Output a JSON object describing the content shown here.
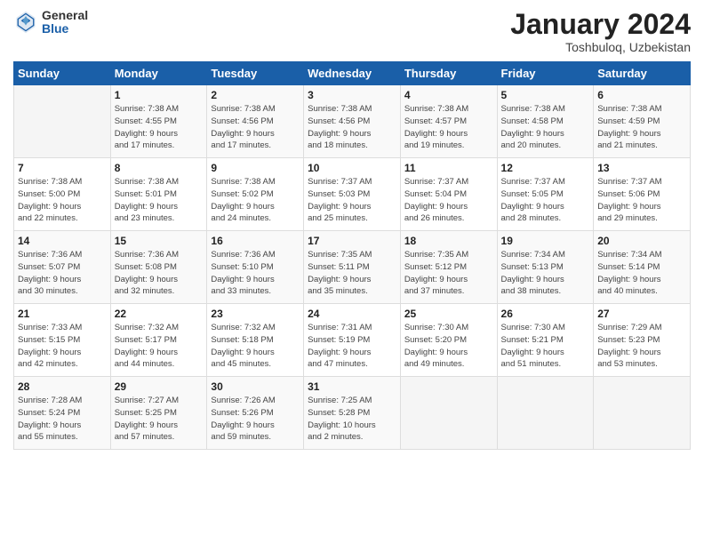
{
  "header": {
    "logo_general": "General",
    "logo_blue": "Blue",
    "month_title": "January 2024",
    "location": "Toshbuloq, Uzbekistan"
  },
  "days_of_week": [
    "Sunday",
    "Monday",
    "Tuesday",
    "Wednesday",
    "Thursday",
    "Friday",
    "Saturday"
  ],
  "weeks": [
    [
      {
        "day": "",
        "info": ""
      },
      {
        "day": "1",
        "info": "Sunrise: 7:38 AM\nSunset: 4:55 PM\nDaylight: 9 hours\nand 17 minutes."
      },
      {
        "day": "2",
        "info": "Sunrise: 7:38 AM\nSunset: 4:56 PM\nDaylight: 9 hours\nand 17 minutes."
      },
      {
        "day": "3",
        "info": "Sunrise: 7:38 AM\nSunset: 4:56 PM\nDaylight: 9 hours\nand 18 minutes."
      },
      {
        "day": "4",
        "info": "Sunrise: 7:38 AM\nSunset: 4:57 PM\nDaylight: 9 hours\nand 19 minutes."
      },
      {
        "day": "5",
        "info": "Sunrise: 7:38 AM\nSunset: 4:58 PM\nDaylight: 9 hours\nand 20 minutes."
      },
      {
        "day": "6",
        "info": "Sunrise: 7:38 AM\nSunset: 4:59 PM\nDaylight: 9 hours\nand 21 minutes."
      }
    ],
    [
      {
        "day": "7",
        "info": "Sunrise: 7:38 AM\nSunset: 5:00 PM\nDaylight: 9 hours\nand 22 minutes."
      },
      {
        "day": "8",
        "info": "Sunrise: 7:38 AM\nSunset: 5:01 PM\nDaylight: 9 hours\nand 23 minutes."
      },
      {
        "day": "9",
        "info": "Sunrise: 7:38 AM\nSunset: 5:02 PM\nDaylight: 9 hours\nand 24 minutes."
      },
      {
        "day": "10",
        "info": "Sunrise: 7:37 AM\nSunset: 5:03 PM\nDaylight: 9 hours\nand 25 minutes."
      },
      {
        "day": "11",
        "info": "Sunrise: 7:37 AM\nSunset: 5:04 PM\nDaylight: 9 hours\nand 26 minutes."
      },
      {
        "day": "12",
        "info": "Sunrise: 7:37 AM\nSunset: 5:05 PM\nDaylight: 9 hours\nand 28 minutes."
      },
      {
        "day": "13",
        "info": "Sunrise: 7:37 AM\nSunset: 5:06 PM\nDaylight: 9 hours\nand 29 minutes."
      }
    ],
    [
      {
        "day": "14",
        "info": "Sunrise: 7:36 AM\nSunset: 5:07 PM\nDaylight: 9 hours\nand 30 minutes."
      },
      {
        "day": "15",
        "info": "Sunrise: 7:36 AM\nSunset: 5:08 PM\nDaylight: 9 hours\nand 32 minutes."
      },
      {
        "day": "16",
        "info": "Sunrise: 7:36 AM\nSunset: 5:10 PM\nDaylight: 9 hours\nand 33 minutes."
      },
      {
        "day": "17",
        "info": "Sunrise: 7:35 AM\nSunset: 5:11 PM\nDaylight: 9 hours\nand 35 minutes."
      },
      {
        "day": "18",
        "info": "Sunrise: 7:35 AM\nSunset: 5:12 PM\nDaylight: 9 hours\nand 37 minutes."
      },
      {
        "day": "19",
        "info": "Sunrise: 7:34 AM\nSunset: 5:13 PM\nDaylight: 9 hours\nand 38 minutes."
      },
      {
        "day": "20",
        "info": "Sunrise: 7:34 AM\nSunset: 5:14 PM\nDaylight: 9 hours\nand 40 minutes."
      }
    ],
    [
      {
        "day": "21",
        "info": "Sunrise: 7:33 AM\nSunset: 5:15 PM\nDaylight: 9 hours\nand 42 minutes."
      },
      {
        "day": "22",
        "info": "Sunrise: 7:32 AM\nSunset: 5:17 PM\nDaylight: 9 hours\nand 44 minutes."
      },
      {
        "day": "23",
        "info": "Sunrise: 7:32 AM\nSunset: 5:18 PM\nDaylight: 9 hours\nand 45 minutes."
      },
      {
        "day": "24",
        "info": "Sunrise: 7:31 AM\nSunset: 5:19 PM\nDaylight: 9 hours\nand 47 minutes."
      },
      {
        "day": "25",
        "info": "Sunrise: 7:30 AM\nSunset: 5:20 PM\nDaylight: 9 hours\nand 49 minutes."
      },
      {
        "day": "26",
        "info": "Sunrise: 7:30 AM\nSunset: 5:21 PM\nDaylight: 9 hours\nand 51 minutes."
      },
      {
        "day": "27",
        "info": "Sunrise: 7:29 AM\nSunset: 5:23 PM\nDaylight: 9 hours\nand 53 minutes."
      }
    ],
    [
      {
        "day": "28",
        "info": "Sunrise: 7:28 AM\nSunset: 5:24 PM\nDaylight: 9 hours\nand 55 minutes."
      },
      {
        "day": "29",
        "info": "Sunrise: 7:27 AM\nSunset: 5:25 PM\nDaylight: 9 hours\nand 57 minutes."
      },
      {
        "day": "30",
        "info": "Sunrise: 7:26 AM\nSunset: 5:26 PM\nDaylight: 9 hours\nand 59 minutes."
      },
      {
        "day": "31",
        "info": "Sunrise: 7:25 AM\nSunset: 5:28 PM\nDaylight: 10 hours\nand 2 minutes."
      },
      {
        "day": "",
        "info": ""
      },
      {
        "day": "",
        "info": ""
      },
      {
        "day": "",
        "info": ""
      }
    ]
  ]
}
